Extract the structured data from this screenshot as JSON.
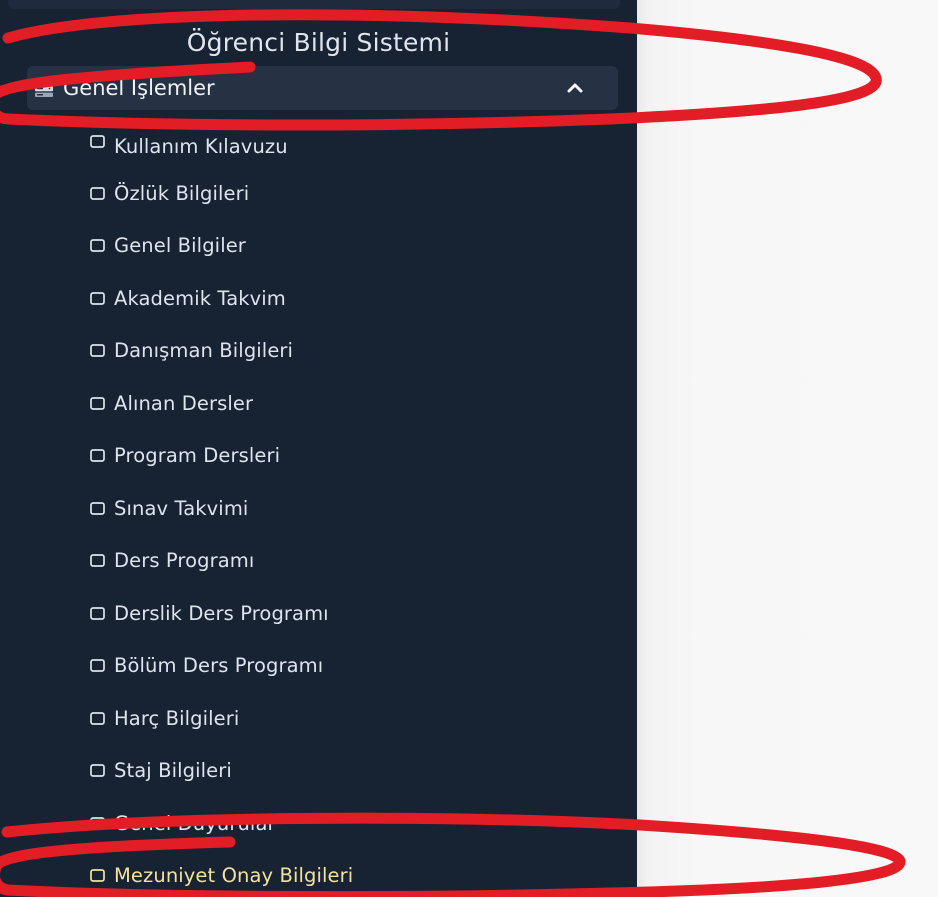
{
  "sidebar": {
    "title": "Öğrenci Bilgi Sistemi",
    "section": {
      "label": "Genel İşlemler",
      "icon": "server-icon",
      "toggle_icon": "chevron-up-icon",
      "expanded": true
    },
    "items": [
      {
        "label": "Kullanım Kılavuzu",
        "icon": "square-icon"
      },
      {
        "label": "Özlük Bilgileri",
        "icon": "square-icon"
      },
      {
        "label": "Genel Bilgiler",
        "icon": "square-icon"
      },
      {
        "label": "Akademik Takvim",
        "icon": "square-icon"
      },
      {
        "label": "Danışman Bilgileri",
        "icon": "square-icon"
      },
      {
        "label": "Alınan Dersler",
        "icon": "square-icon"
      },
      {
        "label": "Program Dersleri",
        "icon": "square-icon"
      },
      {
        "label": "Sınav Takvimi",
        "icon": "square-icon"
      },
      {
        "label": "Ders Programı",
        "icon": "square-icon"
      },
      {
        "label": "Derslik Ders Programı",
        "icon": "square-icon"
      },
      {
        "label": "Bölüm Ders Programı",
        "icon": "square-icon"
      },
      {
        "label": "Harç Bilgileri",
        "icon": "square-icon"
      },
      {
        "label": "Staj Bilgileri",
        "icon": "square-icon"
      },
      {
        "label": "Genel Duyurular",
        "icon": "square-icon"
      },
      {
        "label": "Mezuniyet Onay Bilgileri",
        "icon": "square-icon",
        "highlighted": true
      }
    ]
  },
  "colors": {
    "sidebar_background": "#172232",
    "section_background": "#263243",
    "text": "#dce4ee",
    "highlighted_text": "#f3e1a0",
    "annotation": "#e31d25",
    "main_background": "#f7f7f7"
  }
}
